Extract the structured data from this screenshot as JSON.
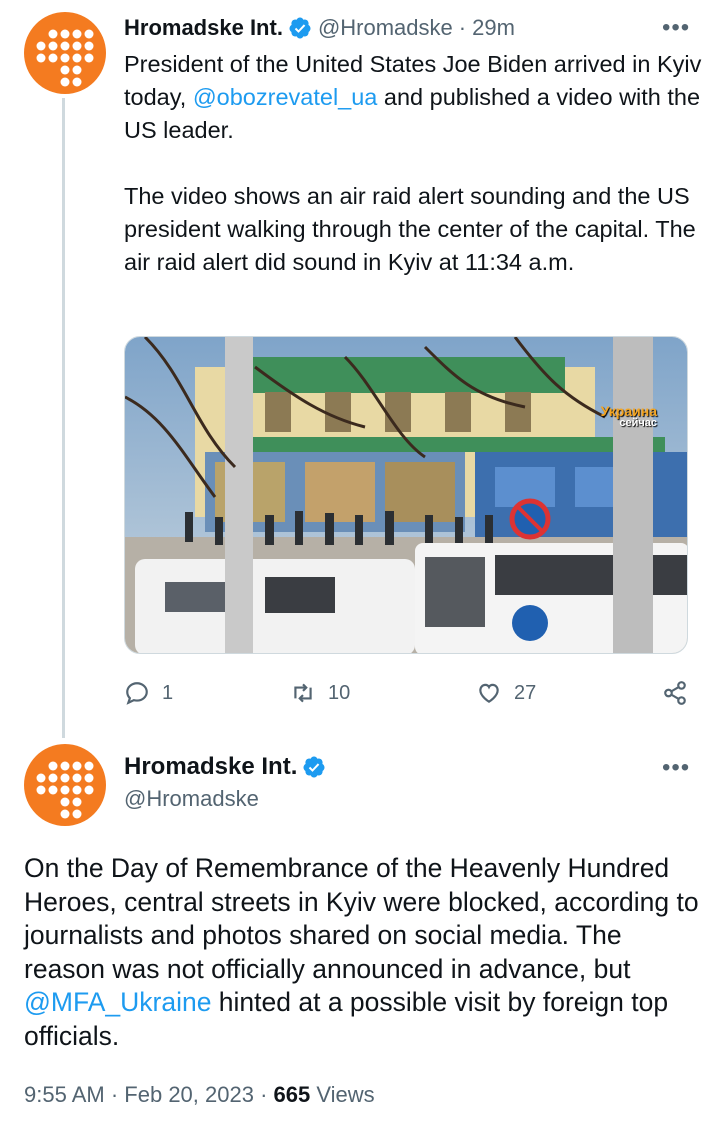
{
  "tweet1": {
    "author_name": "Hromadske Int.",
    "handle": "@Hromadske",
    "separator": "·",
    "time": "29m",
    "more": "•••",
    "text_p1_before": "President of the United States Joe Biden arrived in Kyiv today, ",
    "mention": "@obozrevatel_ua",
    "text_p1_after": " and published a video with the US leader.",
    "text_p2": "The video shows an air raid alert sounding and the US president walking through the center of the capital. The air raid alert did sound in Kyiv at 11:34 a.m.",
    "media_watermark_top": "Украина",
    "media_watermark_bottom": "сейчас",
    "actions": {
      "replies": "1",
      "retweets": "10",
      "likes": "27"
    }
  },
  "tweet2": {
    "author_name": "Hromadske Int.",
    "handle": "@Hromadske",
    "more": "•••",
    "text_before": "On the Day of Remembrance of the Heavenly Hundred Heroes, central streets in Kyiv were blocked, according to journalists and photos shared on social media. The reason was not officially announced in advance, but ",
    "mention": "@MFA_Ukraine",
    "text_after": " hinted at a possible visit by foreign top officials.",
    "time": "9:55 AM",
    "date": "Feb 20, 2023",
    "views_count": "665",
    "views_label": "Views"
  },
  "colors": {
    "avatar": "#f47b20",
    "link": "#1d9bf0",
    "verified": "#1d9bf0",
    "muted": "#536471"
  },
  "icons": [
    "verified-badge-icon",
    "reply-icon",
    "retweet-icon",
    "like-icon",
    "share-icon",
    "more-icon"
  ]
}
